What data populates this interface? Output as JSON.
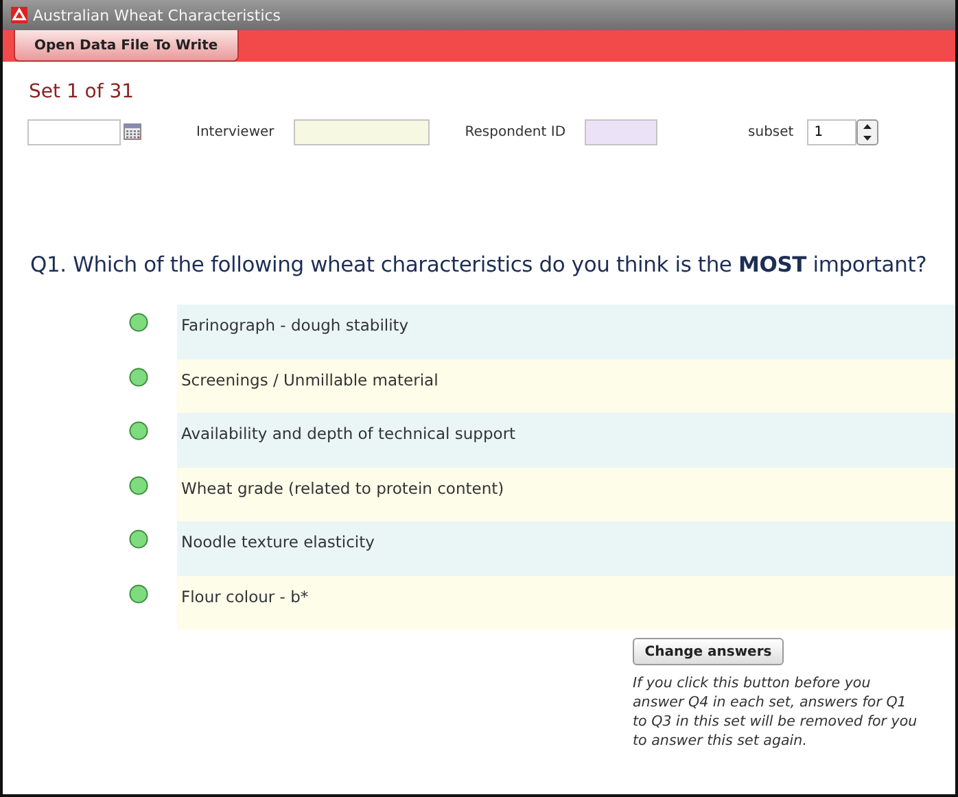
{
  "window": {
    "title": "Australian Wheat Characteristics"
  },
  "toolbar": {
    "button": "Open Data File To Write"
  },
  "set_label": "Set 1 of 31",
  "fields": [
    {
      "kind": "date"
    },
    {
      "kind": "text",
      "label": "Interviewer",
      "color": "#f6f8e2"
    },
    {
      "kind": "text",
      "label": "Respondent ID",
      "color": "#ece2f8"
    },
    {
      "kind": "spin",
      "label": "subset",
      "value": "1"
    }
  ],
  "question": "Q1. Which of the following wheat characteristics do you think is the **MOST** important?",
  "options": [
    {
      "label": "Farinograph - dough stability",
      "selected": false
    },
    {
      "label": "Screenings / Unmillable material",
      "selected": false
    },
    {
      "label": "Availability and depth of technical support",
      "selected": false
    },
    {
      "label": "Wheat grade (related to protein content)",
      "selected": false
    },
    {
      "label": "Noodle texture elasticity",
      "selected": false
    },
    {
      "label": "Flour colour - b*",
      "selected": false
    }
  ],
  "change_button": "Change answers",
  "note": "If you click this button before you answer Q4 in each set, answers for Q1 to Q3 in this set will be removed for you to answer this set again."
}
